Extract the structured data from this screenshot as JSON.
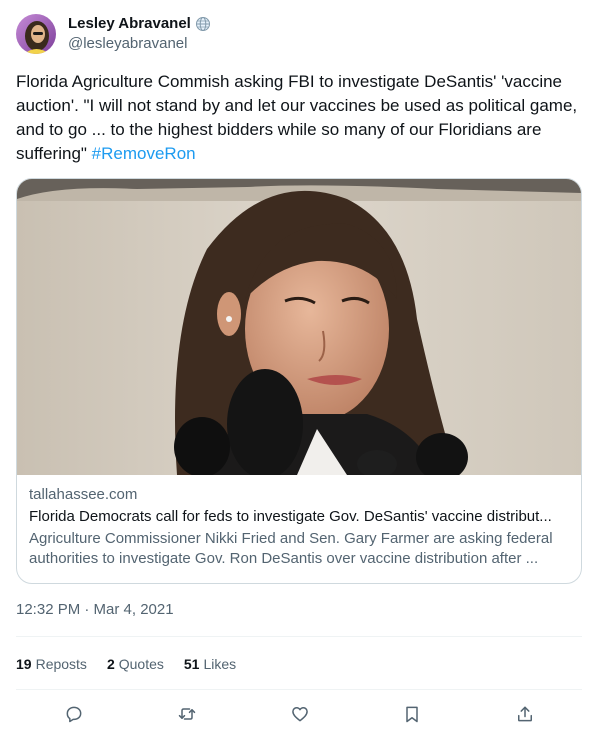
{
  "author": {
    "display_name": "Lesley Abravanel",
    "handle": "@lesleyabravanel"
  },
  "tweet": {
    "text": "Florida Agriculture Commish asking FBI to investigate DeSantis' 'vaccine auction'. \"I will not stand by and let our vaccines be used as political game, and to go ... to the highest bidders while so many of our Floridians are suffering\" ",
    "hashtag": "#RemoveRon",
    "timestamp": "12:32 PM · Mar 4, 2021"
  },
  "card": {
    "domain": "tallahassee.com",
    "title": "Florida Democrats call for feds to investigate Gov. DeSantis' vaccine distribut...",
    "description": "Agriculture Commissioner Nikki Fried and Sen. Gary Farmer are asking federal authorities to investigate Gov. Ron DeSantis over vaccine distribution after ..."
  },
  "stats": {
    "reposts_count": "19",
    "reposts_label": "Reposts",
    "quotes_count": "2",
    "quotes_label": "Quotes",
    "likes_count": "51",
    "likes_label": "Likes"
  },
  "icons": {
    "verified": "globe-icon",
    "reply": "reply-icon",
    "repost": "repost-icon",
    "like": "heart-icon",
    "bookmark": "bookmark-icon",
    "share": "share-icon"
  },
  "colors": {
    "link": "#1d9bf0",
    "secondary_text": "#536471",
    "border": "#cfd9de"
  }
}
